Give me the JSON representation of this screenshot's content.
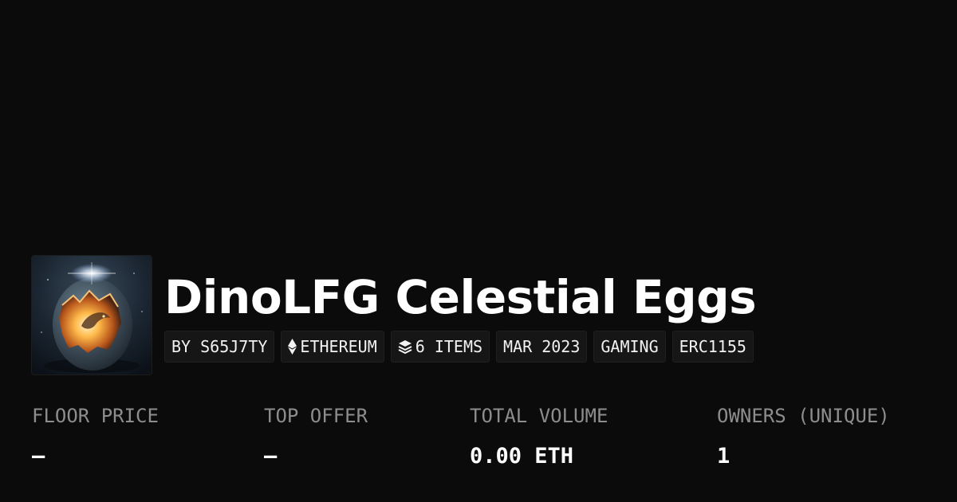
{
  "collection": {
    "title": "DinoLFG Celestial Eggs",
    "image_subject": "glowing cracked dinosaur egg"
  },
  "chips": {
    "creator": "BY S65J7TY",
    "chain": "ETHEREUM",
    "chain_icon": "ethereum-icon",
    "items": "6 ITEMS",
    "items_icon": "layers-icon",
    "date": "MAR 2023",
    "category": "GAMING",
    "standard": "ERC1155"
  },
  "stats": {
    "floor_price": {
      "label": "FLOOR PRICE",
      "value": "—"
    },
    "top_offer": {
      "label": "TOP OFFER",
      "value": "—"
    },
    "total_volume": {
      "label": "TOTAL VOLUME",
      "value": "0.00 ETH"
    },
    "owners": {
      "label": "OWNERS (UNIQUE)",
      "value": "1"
    }
  },
  "colors": {
    "background": "#0b0b0b",
    "chip_background": "#161616",
    "label": "#8d8d8d",
    "text": "#ffffff"
  }
}
